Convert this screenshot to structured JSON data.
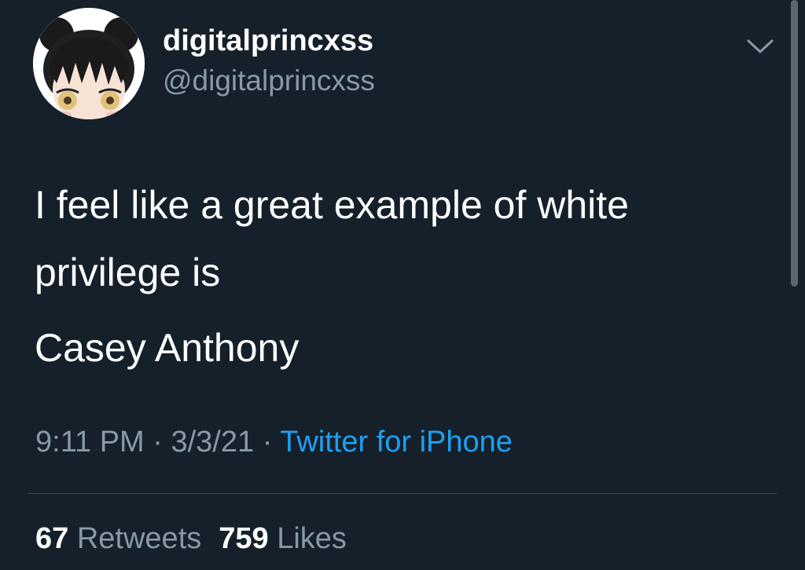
{
  "tweet": {
    "display_name": "digitalprincxss",
    "handle": "@digitalprincxss",
    "text_lines": [
      "I feel like a great example of white",
      "privilege is"
    ],
    "text_second_paragraph": "Casey Anthony",
    "time": "9:11 PM",
    "separator": "·",
    "date": "3/3/21",
    "source": "Twitter for iPhone",
    "retweets_count": "67",
    "retweets_label": "Retweets",
    "likes_count": "759",
    "likes_label": "Likes"
  },
  "icons": {
    "menu": "chevron-down-icon",
    "avatar": "anime-girl-avatar"
  },
  "colors": {
    "background": "#15202b",
    "primary_text": "#ffffff",
    "secondary_text": "#8899a6",
    "link": "#1da1f2",
    "divider": "#38444d"
  }
}
